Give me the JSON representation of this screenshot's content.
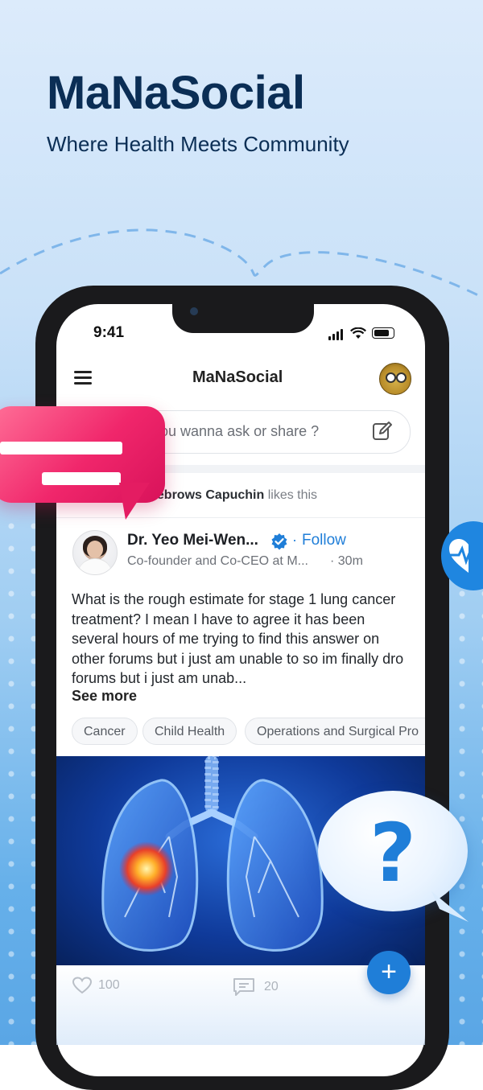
{
  "hero": {
    "title": "MaNaSocial",
    "subtitle": "Where Health Meets Community"
  },
  "status_bar": {
    "time": "9:41"
  },
  "app_bar": {
    "title": "MaNaSocial",
    "menu_icon": "hamburger-icon",
    "avatar_icon": "user-avatar"
  },
  "composer": {
    "placeholder": "you wanna ask or share ?",
    "icon": "edit-icon"
  },
  "activity": {
    "actor": "yebrows Capuchin",
    "action": "likes this"
  },
  "post": {
    "author": "Dr. Yeo Mei-Wen...",
    "follow_label": "Follow",
    "author_title": "Co-founder and Co-CEO at M...",
    "time": "30m",
    "body": "What is the rough estimate for stage 1 lung cancer treatment? I mean I have to agree it has been several hours of me trying to find this answer on other  forums but i just am unable to so im finally dro  forums but i just am unab...",
    "see_more": "See more",
    "tags": [
      "Cancer",
      "Child Health",
      "Operations and Surgical Pro"
    ]
  },
  "post_stats": {
    "likes": "100",
    "comments": "20"
  },
  "fab": {
    "label": "+"
  },
  "colors": {
    "brand_dark": "#0b2e55",
    "accent": "#1f7ed8",
    "pink": "#f0266b"
  }
}
